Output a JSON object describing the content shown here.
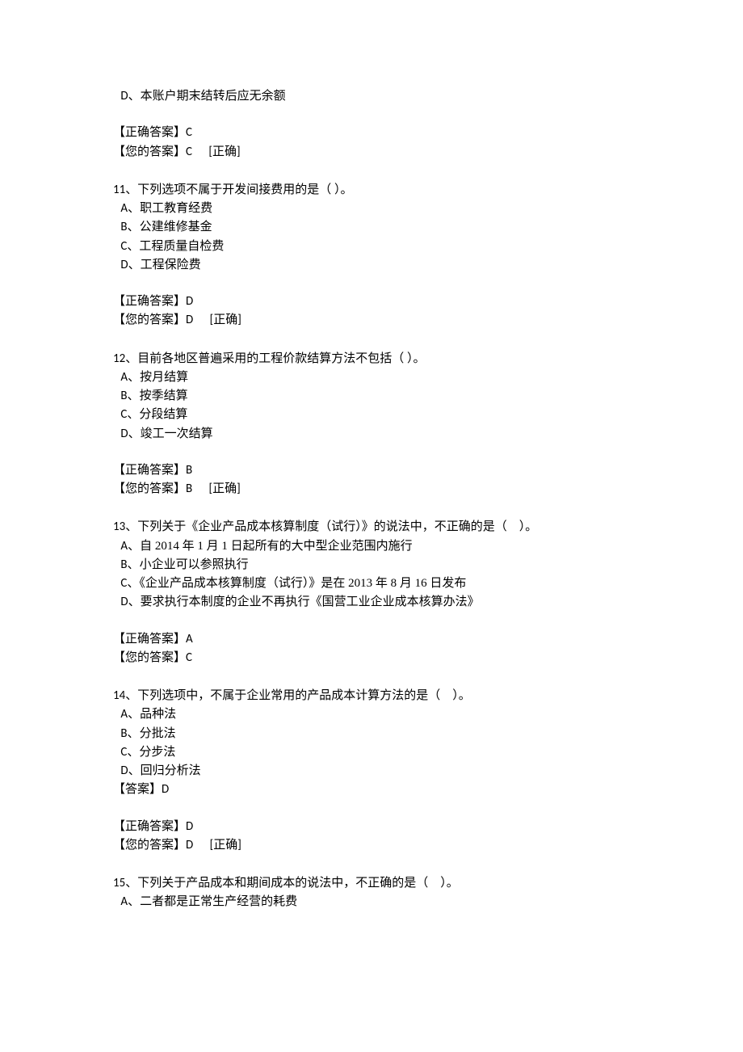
{
  "questions": [
    {
      "partial": true,
      "options": [
        {
          "opt_label": " D、",
          "text": "本账户期末结转后应无余额"
        }
      ],
      "correct_label": "【正确答案】",
      "correct_value": "C",
      "your_label": "【您的答案】",
      "your_value": "C",
      "result_tag": "      [正确]"
    },
    {
      "stem_num": "11、",
      "stem_text": "下列选项不属于开发间接费用的是（ ）。",
      "options": [
        {
          "opt_label": " A、",
          "text": "职工教育经费"
        },
        {
          "opt_label": " B、",
          "text": "公建维修基金"
        },
        {
          "opt_label": " C、",
          "text": "工程质量自检费"
        },
        {
          "opt_label": " D、",
          "text": "工程保险费"
        }
      ],
      "correct_label": "【正确答案】",
      "correct_value": "D",
      "your_label": "【您的答案】",
      "your_value": "D",
      "result_tag": "      [正确]"
    },
    {
      "stem_num": "12、",
      "stem_text": "目前各地区普遍采用的工程价款结算方法不包括（ ）。",
      "options": [
        {
          "opt_label": " A、",
          "text": "按月结算"
        },
        {
          "opt_label": " B、",
          "text": "按季结算"
        },
        {
          "opt_label": " C、",
          "text": "分段结算"
        },
        {
          "opt_label": " D、",
          "text": "竣工一次结算"
        }
      ],
      "correct_label": "【正确答案】",
      "correct_value": "B",
      "your_label": "【您的答案】",
      "your_value": "B",
      "result_tag": "      [正确]"
    },
    {
      "stem_num": "13、",
      "stem_text": "下列关于《企业产品成本核算制度（试行）》的说法中，不正确的是（　）。",
      "options": [
        {
          "opt_label": " A、",
          "text": "自 2014 年 1 月 1 日起所有的大中型企业范围内施行"
        },
        {
          "opt_label": " B、",
          "text": "小企业可以参照执行"
        },
        {
          "opt_label": " C、",
          "text": "《企业产品成本核算制度（试行）》是在 2013 年 8 月 16 日发布"
        },
        {
          "opt_label": " D、",
          "text": "要求执行本制度的企业不再执行《国营工业企业成本核算办法》"
        }
      ],
      "correct_label": "【正确答案】",
      "correct_value": "A",
      "your_label": "【您的答案】",
      "your_value": "C",
      "result_tag": ""
    },
    {
      "stem_num": "14、",
      "stem_text": "下列选项中，不属于企业常用的产品成本计算方法的是（　）。",
      "options": [
        {
          "opt_label": " A、",
          "text": "品种法"
        },
        {
          "opt_label": " B、",
          "text": "分批法"
        },
        {
          "opt_label": " C、",
          "text": "分步法"
        },
        {
          "opt_label": " D、",
          "text": "回归分析法"
        }
      ],
      "inline_answer_label": "【答案】",
      "inline_answer_value": "D",
      "correct_label": "【正确答案】",
      "correct_value": "D",
      "your_label": "【您的答案】",
      "your_value": "D",
      "result_tag": "      [正确]"
    },
    {
      "stem_num": "15、",
      "stem_text": "下列关于产品成本和期间成本的说法中，不正确的是（　）。",
      "options": [
        {
          "opt_label": " A、",
          "text": "二者都是正常生产经营的耗费"
        }
      ],
      "no_answer_block": true
    }
  ]
}
